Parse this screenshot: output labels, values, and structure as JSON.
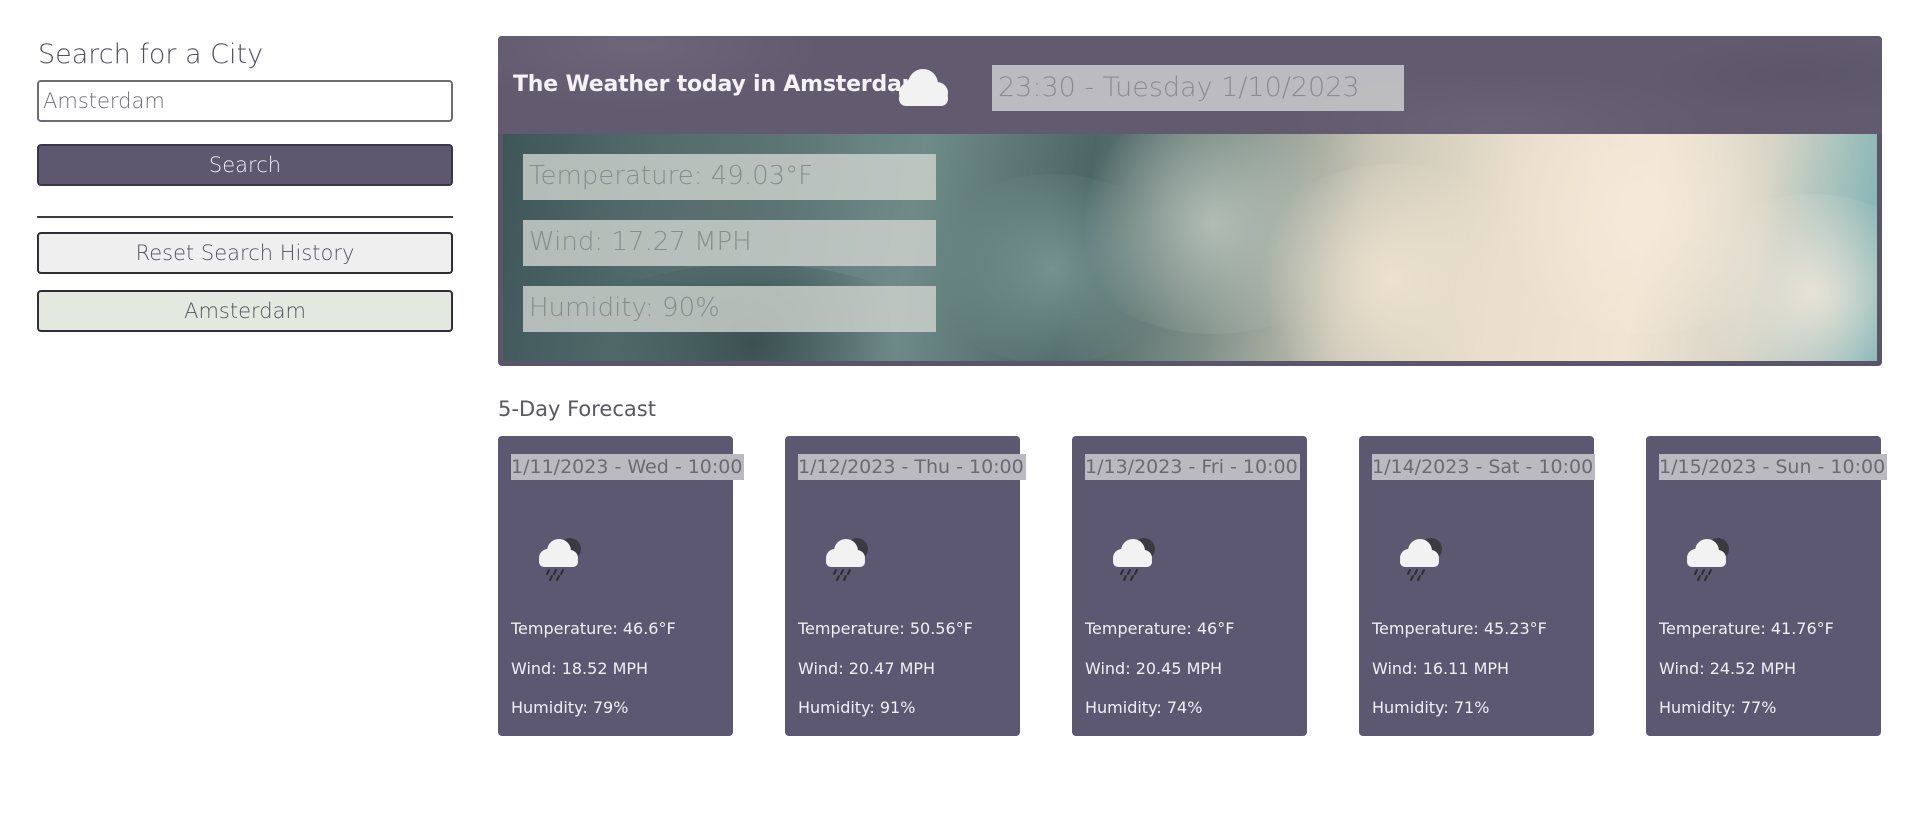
{
  "sidebar": {
    "title": "Search for a City",
    "input_value": "Amsterdam",
    "search_label": "Search",
    "reset_label": "Reset Search History",
    "history": [
      "Amsterdam"
    ]
  },
  "current": {
    "title": "The Weather today in Amsterdam",
    "icon": "cloud-icon",
    "datetime": "23:30 - Tuesday 1/10/2023",
    "temperature": "Temperature: 49.03°F",
    "wind": "Wind: 17.27 MPH",
    "humidity": "Humidity: 90%"
  },
  "forecast": {
    "title": "5-Day Forecast",
    "days": [
      {
        "date": "1/11/2023 - Wed - 10:00",
        "icon": "rain-cloud-icon",
        "temp": "Temperature: 46.6°F",
        "wind": "Wind: 18.52 MPH",
        "humidity": "Humidity: 79%"
      },
      {
        "date": "1/12/2023 - Thu - 10:00",
        "icon": "rain-cloud-icon",
        "temp": "Temperature: 50.56°F",
        "wind": "Wind: 20.47 MPH",
        "humidity": "Humidity: 91%"
      },
      {
        "date": "1/13/2023 - Fri - 10:00",
        "icon": "rain-cloud-icon",
        "temp": "Temperature: 46°F",
        "wind": "Wind: 20.45 MPH",
        "humidity": "Humidity: 74%"
      },
      {
        "date": "1/14/2023 - Sat - 10:00",
        "icon": "rain-cloud-icon",
        "temp": "Temperature: 45.23°F",
        "wind": "Wind: 16.11 MPH",
        "humidity": "Humidity: 71%"
      },
      {
        "date": "1/15/2023 - Sun - 10:00",
        "icon": "rain-cloud-icon",
        "temp": "Temperature: 41.76°F",
        "wind": "Wind: 24.52 MPH",
        "humidity": "Humidity: 77%"
      }
    ]
  },
  "colors": {
    "primary": "#5d576f",
    "history_bg": "#e3e9df",
    "reset_bg": "#efefef"
  }
}
